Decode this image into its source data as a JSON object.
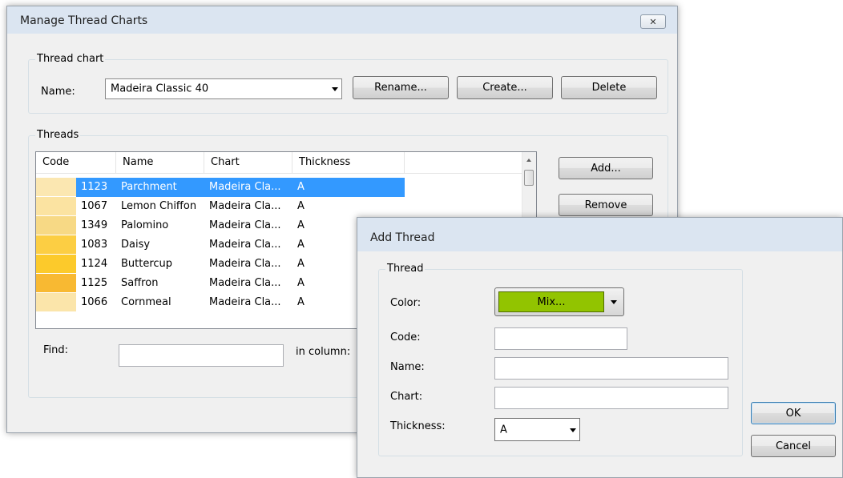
{
  "manage": {
    "title": "Manage Thread Charts",
    "close_label": "✕",
    "thread_chart_group": "Thread chart",
    "name_label": "Name:",
    "name_value": "Madeira Classic 40",
    "rename_label": "Rename...",
    "create_label": "Create...",
    "delete_label": "Delete",
    "threads_group": "Threads",
    "columns": [
      "Code",
      "Name",
      "Chart",
      "Thickness"
    ],
    "rows": [
      {
        "color": "#fbe7b1",
        "code": "1123",
        "name": "Parchment",
        "chart": "Madeira Cla...",
        "thickness": "A",
        "selected": true
      },
      {
        "color": "#fbe3a1",
        "code": "1067",
        "name": "Lemon Chiffon",
        "chart": "Madeira Cla...",
        "thickness": "A",
        "selected": false
      },
      {
        "color": "#f7d985",
        "code": "1349",
        "name": "Palomino",
        "chart": "Madeira Cla...",
        "thickness": "A",
        "selected": false
      },
      {
        "color": "#fcce43",
        "code": "1083",
        "name": "Daisy",
        "chart": "Madeira Cla...",
        "thickness": "A",
        "selected": false
      },
      {
        "color": "#fcca2b",
        "code": "1124",
        "name": "Buttercup",
        "chart": "Madeira Cla...",
        "thickness": "A",
        "selected": false
      },
      {
        "color": "#f8b932",
        "code": "1125",
        "name": "Saffron",
        "chart": "Madeira Cla...",
        "thickness": "A",
        "selected": false
      },
      {
        "color": "#fbe5aa",
        "code": "1066",
        "name": "Cornmeal",
        "chart": "Madeira Cla...",
        "thickness": "A",
        "selected": false
      }
    ],
    "add_label": "Add...",
    "remove_label": "Remove",
    "find_label": "Find:",
    "find_value": "",
    "in_column_label": "in column:"
  },
  "add_thread": {
    "title": "Add Thread",
    "group_label": "Thread",
    "color_label": "Color:",
    "color_button_label": "Mix...",
    "color_value": "#92c400",
    "code_label": "Code:",
    "code_value": "",
    "name_label": "Name:",
    "name_value": "",
    "chart_label": "Chart:",
    "chart_value": "",
    "thickness_label": "Thickness:",
    "thickness_value": "A",
    "ok_label": "OK",
    "cancel_label": "Cancel"
  }
}
